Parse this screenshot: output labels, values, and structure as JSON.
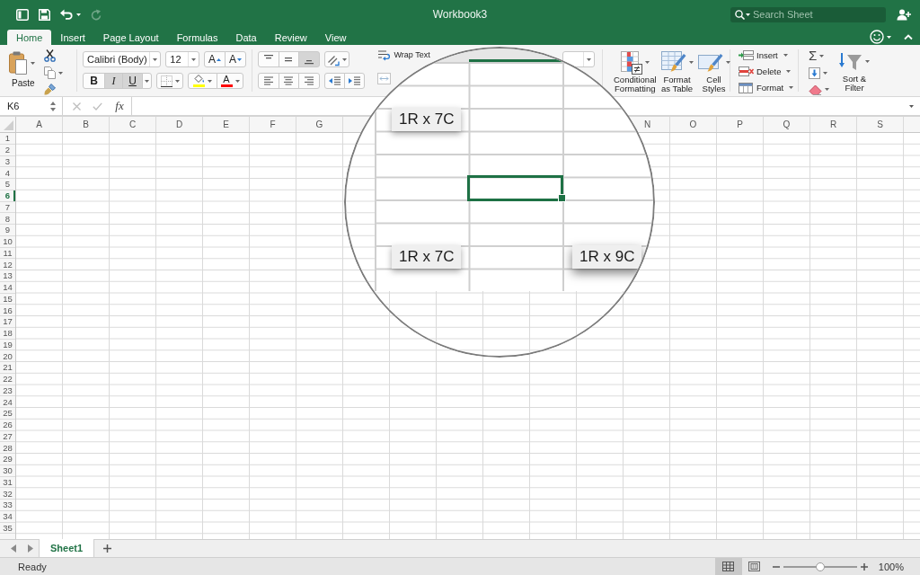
{
  "title_bar": {
    "quick_access": [
      {
        "kind": "sidebar",
        "disabled": false
      },
      {
        "kind": "save",
        "disabled": false
      },
      {
        "kind": "undo",
        "disabled": false
      },
      {
        "kind": "redo",
        "disabled": true
      }
    ],
    "title": "Workbook3",
    "search": {
      "placeholder": "Search Sheet"
    }
  },
  "tabs": [
    {
      "label": "Home",
      "selected": true
    },
    {
      "label": "Insert",
      "selected": false
    },
    {
      "label": "Page Layout",
      "selected": false
    },
    {
      "label": "Formulas",
      "selected": false
    },
    {
      "label": "Data",
      "selected": false
    },
    {
      "label": "Review",
      "selected": false
    },
    {
      "label": "View",
      "selected": false
    }
  ],
  "ribbon": {
    "paste": "Paste",
    "font": {
      "name": "Calibri (Body)",
      "size": "12",
      "grow": "A",
      "shrink": "A",
      "styles": [
        {
          "kind": "bold",
          "label": "B",
          "on": false
        },
        {
          "kind": "italic",
          "label": "I",
          "on": true
        },
        {
          "kind": "underline",
          "label": "U",
          "on": true
        }
      ],
      "color_buttons": [
        {
          "kind": "fill",
          "color": "#ffff00"
        },
        {
          "kind": "text",
          "label": "A",
          "color": "#ff0000"
        }
      ]
    },
    "alignment": {
      "vertical": [
        {
          "kind": "top",
          "selected": false
        },
        {
          "kind": "middle",
          "selected": false
        },
        {
          "kind": "bottom",
          "selected": true
        }
      ],
      "horizontal": [
        {
          "kind": "left",
          "selected": false
        },
        {
          "kind": "center",
          "selected": false
        },
        {
          "kind": "right",
          "selected": false
        }
      ],
      "wrap_text": "Wrap Text"
    },
    "styles": [
      {
        "kind": "conditional",
        "lines": [
          "Conditional",
          "Formatting"
        ]
      },
      {
        "kind": "table",
        "lines": [
          "Format",
          "as Table"
        ]
      },
      {
        "kind": "cell",
        "lines": [
          "Cell",
          "Styles"
        ]
      }
    ],
    "cells": [
      {
        "kind": "insert",
        "label": "Insert"
      },
      {
        "kind": "delete",
        "label": "Delete"
      },
      {
        "kind": "format",
        "label": "Format"
      }
    ],
    "editing": {
      "autosum": "Σ",
      "sort_lines": [
        "Sort &",
        "Filter"
      ]
    }
  },
  "formula_bar": {
    "name_box": "K6",
    "edit_buttons": [
      {
        "kind": "cancel",
        "disabled": true
      },
      {
        "kind": "enter",
        "disabled": true
      }
    ],
    "function_label": "fx"
  },
  "column_headers": {
    "left": [
      "A",
      "B",
      "C",
      "D",
      "E",
      "F",
      "G"
    ],
    "right": [
      "N",
      "O",
      "P",
      "Q",
      "R",
      "S"
    ]
  },
  "rows": [
    {
      "label": "1",
      "selected": false
    },
    {
      "label": "2",
      "selected": false
    },
    {
      "label": "3",
      "selected": false
    },
    {
      "label": "4",
      "selected": false
    },
    {
      "label": "5",
      "selected": false
    },
    {
      "label": "6",
      "selected": true
    },
    {
      "label": "7",
      "selected": false
    },
    {
      "label": "8",
      "selected": false
    },
    {
      "label": "9",
      "selected": false
    },
    {
      "label": "10",
      "selected": false
    },
    {
      "label": "11",
      "selected": false
    },
    {
      "label": "12",
      "selected": false
    },
    {
      "label": "13",
      "selected": false
    },
    {
      "label": "14",
      "selected": false
    },
    {
      "label": "15",
      "selected": false
    },
    {
      "label": "16",
      "selected": false
    },
    {
      "label": "17",
      "selected": false
    },
    {
      "label": "18",
      "selected": false
    },
    {
      "label": "19",
      "selected": false
    },
    {
      "label": "20",
      "selected": false
    },
    {
      "label": "21",
      "selected": false
    },
    {
      "label": "22",
      "selected": false
    },
    {
      "label": "23",
      "selected": false
    },
    {
      "label": "24",
      "selected": false
    },
    {
      "label": "25",
      "selected": false
    },
    {
      "label": "26",
      "selected": false
    },
    {
      "label": "27",
      "selected": false
    },
    {
      "label": "28",
      "selected": false
    },
    {
      "label": "29",
      "selected": false
    },
    {
      "label": "30",
      "selected": false
    },
    {
      "label": "31",
      "selected": false
    },
    {
      "label": "32",
      "selected": false
    },
    {
      "label": "33",
      "selected": false
    },
    {
      "label": "34",
      "selected": false
    },
    {
      "label": "35",
      "selected": false
    }
  ],
  "magnifier": {
    "tooltips": [
      "1R x 7C",
      "1R x 7C",
      "1R x 9C"
    ]
  },
  "sheet_tabs": [
    {
      "label": "Sheet1",
      "selected": true
    }
  ],
  "status_bar": {
    "status": "Ready",
    "views": [
      {
        "kind": "normal",
        "selected": true
      },
      {
        "kind": "page_layout",
        "selected": false
      }
    ],
    "zoom": {
      "level": 0.5,
      "reading": "100%"
    }
  }
}
